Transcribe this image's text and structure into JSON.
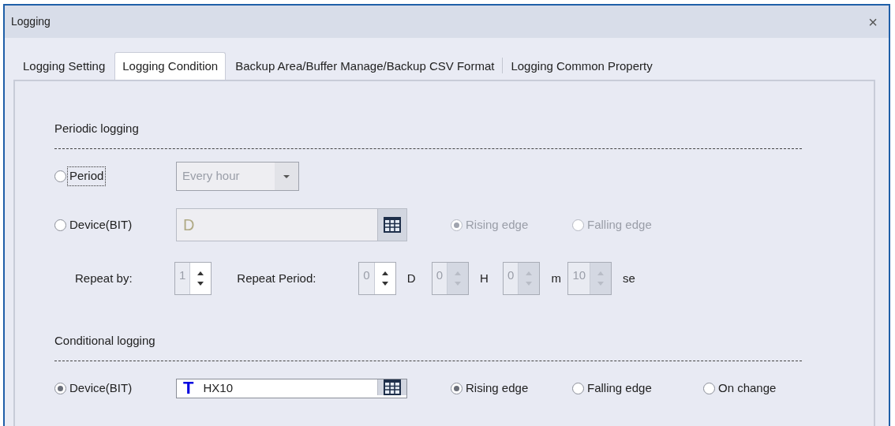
{
  "window": {
    "title": "Logging",
    "close": "×"
  },
  "tabs": [
    {
      "label": "Logging Setting",
      "selected": false
    },
    {
      "label": "Logging Condition",
      "selected": true
    },
    {
      "label": "Backup Area/Buffer Manage/Backup CSV Format",
      "selected": false
    },
    {
      "label": "Logging Common Property",
      "selected": false
    }
  ],
  "periodic": {
    "heading": "Periodic logging",
    "period": {
      "label": "Period",
      "selected": false,
      "focused": true,
      "dropdown": {
        "value": "Every hour",
        "disabled": true
      }
    },
    "device": {
      "label": "Device(BIT)",
      "selected": false,
      "field": {
        "value": "D",
        "disabled": true
      },
      "edges": [
        {
          "label": "Rising edge",
          "selected": true,
          "disabled": true
        },
        {
          "label": "Falling edge",
          "selected": false,
          "disabled": true
        }
      ]
    },
    "repeat_by": {
      "label": "Repeat by:",
      "value": "1",
      "buttons_disabled": false
    },
    "repeat_period": {
      "label": "Repeat Period:",
      "fields": [
        {
          "value": "0",
          "unit": "D",
          "buttons_disabled": false
        },
        {
          "value": "0",
          "unit": "H",
          "buttons_disabled": true
        },
        {
          "value": "0",
          "unit": "m",
          "buttons_disabled": true
        },
        {
          "value": "10",
          "unit": "se",
          "buttons_disabled": true
        }
      ]
    }
  },
  "conditional": {
    "heading": "Conditional logging",
    "device": {
      "label": "Device(BIT)",
      "selected": true,
      "field": {
        "type_mark": "T",
        "value": "HX10",
        "disabled": false
      },
      "edges": [
        {
          "label": "Rising edge",
          "selected": true,
          "disabled": false
        },
        {
          "label": "Falling edge",
          "selected": false,
          "disabled": false
        },
        {
          "label": "On change",
          "selected": false,
          "disabled": false
        }
      ]
    }
  }
}
